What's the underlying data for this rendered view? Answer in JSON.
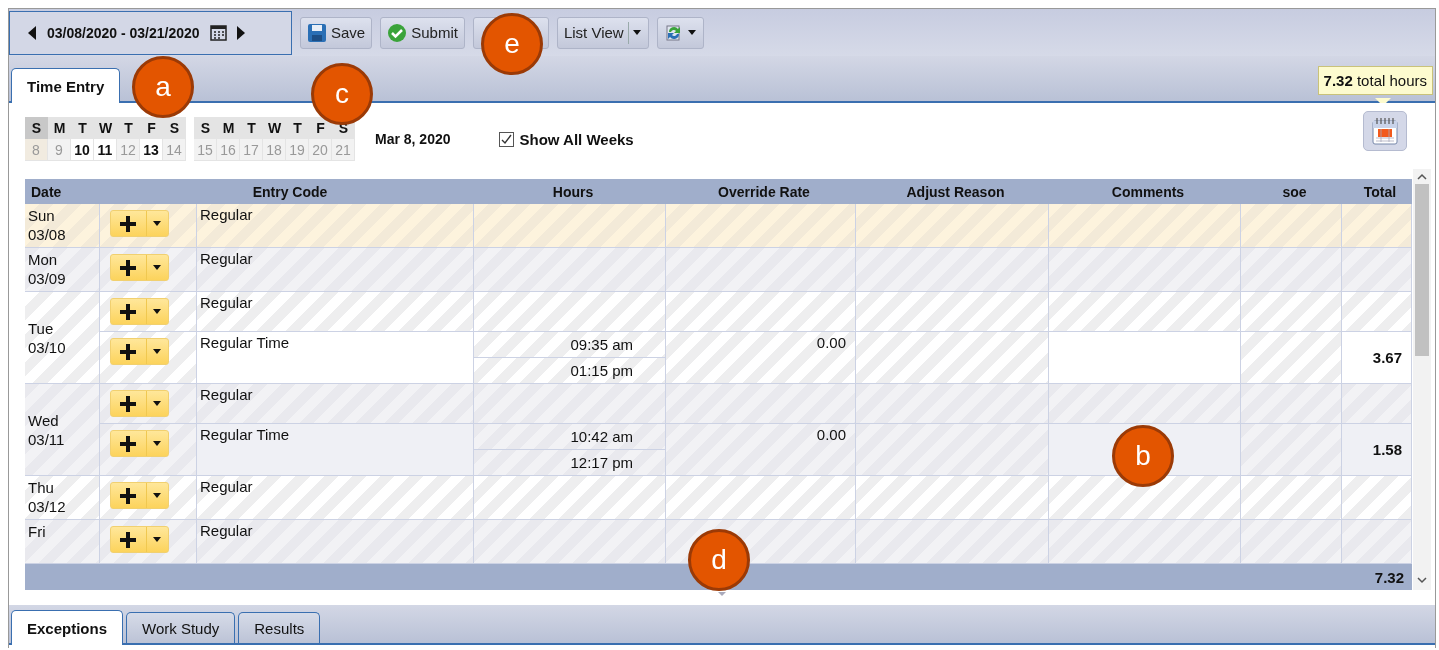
{
  "toolbar": {
    "date_range": "03/08/2020 - 03/21/2020",
    "buttons": [
      {
        "kind": "save",
        "label": "Save"
      },
      {
        "kind": "submit",
        "label": "Submit"
      }
    ],
    "view_menu": {
      "label": "List View"
    }
  },
  "tabs": [
    {
      "label": "Time Entry",
      "selected": true
    }
  ],
  "tooltip": "**7.32** total hours",
  "weeks": [
    {
      "days": [
        {
          "letter": "S",
          "number": "8",
          "selected": true,
          "has_entries": false
        },
        {
          "letter": "M",
          "number": "9",
          "selected": false,
          "has_entries": false
        },
        {
          "letter": "T",
          "number": "10",
          "selected": false,
          "has_entries": true
        },
        {
          "letter": "W",
          "number": "11",
          "selected": false,
          "has_entries": true
        },
        {
          "letter": "T",
          "number": "12",
          "selected": false,
          "has_entries": false
        },
        {
          "letter": "F",
          "number": "13",
          "selected": false,
          "has_entries": true
        },
        {
          "letter": "S",
          "number": "14",
          "selected": false,
          "has_entries": false
        }
      ]
    },
    {
      "days": [
        {
          "letter": "S",
          "number": "15",
          "selected": false,
          "has_entries": false
        },
        {
          "letter": "M",
          "number": "16",
          "selected": false,
          "has_entries": false
        },
        {
          "letter": "T",
          "number": "17",
          "selected": false,
          "has_entries": false
        },
        {
          "letter": "W",
          "number": "18",
          "selected": false,
          "has_entries": false
        },
        {
          "letter": "T",
          "number": "19",
          "selected": false,
          "has_entries": false
        },
        {
          "letter": "F",
          "number": "20",
          "selected": false,
          "has_entries": false
        },
        {
          "letter": "S",
          "number": "21",
          "selected": false,
          "has_entries": false
        }
      ]
    }
  ],
  "current_date": "Mar 8, 2020",
  "show_all_weeks": {
    "label": "Show All Weeks",
    "checked": true
  },
  "table": {
    "columns": [
      "Date",
      "Entry Code",
      "Hours",
      "Override Rate",
      "Adjust Reason",
      "Comments",
      "soe",
      "Total"
    ],
    "days": [
      {
        "weekday": "Sun",
        "date": "03/08",
        "selected": true,
        "entries": [
          {
            "kind": "plain",
            "code": "Regular"
          }
        ]
      },
      {
        "weekday": "Mon",
        "date": "03/09",
        "selected": false,
        "entries": [
          {
            "kind": "plain",
            "code": "Regular"
          }
        ]
      },
      {
        "weekday": "Tue",
        "date": "03/10",
        "selected": false,
        "entries": [
          {
            "kind": "plain",
            "code": "Regular"
          },
          {
            "kind": "time",
            "code": "Regular Time",
            "times": [
              "09:35 am",
              "01:15 pm"
            ],
            "rate": "0.00",
            "total": "3.67"
          }
        ]
      },
      {
        "weekday": "Wed",
        "date": "03/11",
        "selected": false,
        "entries": [
          {
            "kind": "plain",
            "code": "Regular"
          },
          {
            "kind": "time",
            "code": "Regular Time",
            "times": [
              "10:42 am",
              "12:17 pm"
            ],
            "rate": "0.00",
            "total": "1.58"
          }
        ]
      },
      {
        "weekday": "Thu",
        "date": "03/12",
        "selected": false,
        "entries": [
          {
            "kind": "plain",
            "code": "Regular"
          }
        ]
      },
      {
        "weekday": "Fri",
        "selected": false,
        "entries": [
          {
            "kind": "plain",
            "code": "Regular"
          }
        ]
      }
    ],
    "footer_total": "7.32"
  },
  "bottom_tabs": [
    {
      "label": "Exceptions",
      "selected": true
    },
    {
      "label": "Work Study",
      "selected": false
    },
    {
      "label": "Results",
      "selected": false
    }
  ],
  "callouts": [
    "a",
    "c",
    "e",
    "b",
    "d"
  ]
}
